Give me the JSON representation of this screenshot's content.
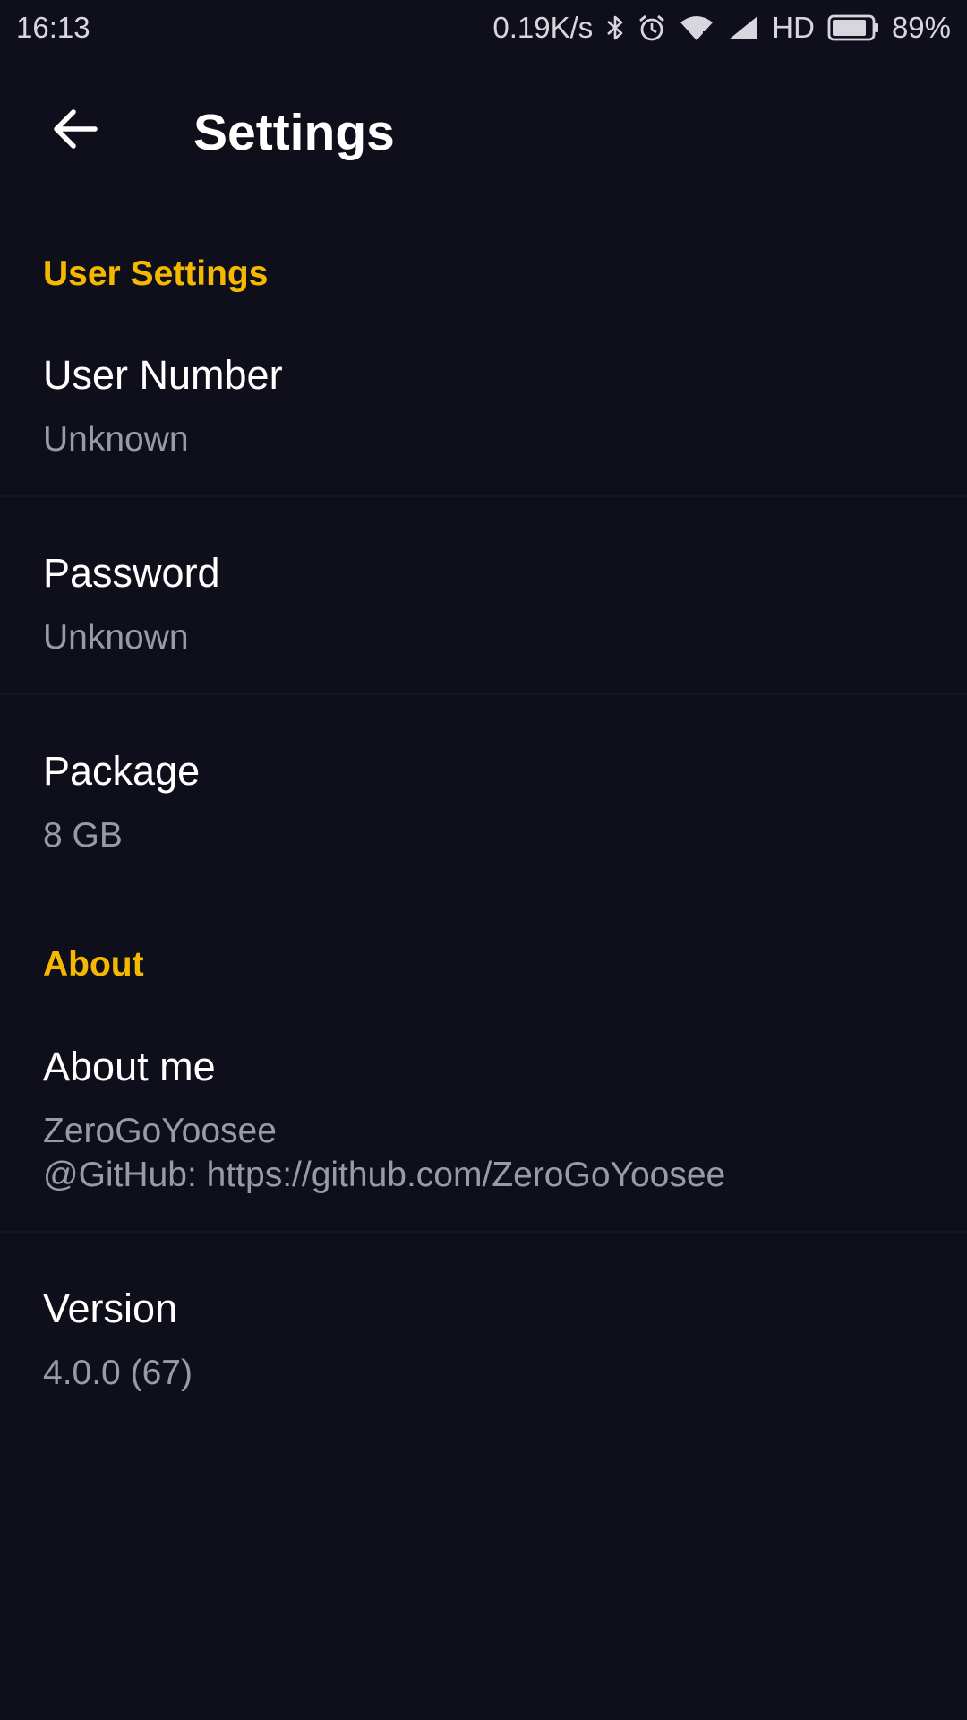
{
  "status_bar": {
    "time": "16:13",
    "net_speed": "0.19K/s",
    "network_type": "HD",
    "battery_percent": "89%",
    "battery_level": 0.89,
    "icons": [
      "bluetooth-icon",
      "alarm-icon",
      "wifi-icon",
      "cell-signal-icon",
      "battery-icon"
    ]
  },
  "app_bar": {
    "title": "Settings",
    "back_icon": "arrow-back-icon"
  },
  "sections": {
    "user_settings": {
      "header": "User Settings",
      "items": [
        {
          "title": "User Number",
          "summary": "Unknown"
        },
        {
          "title": "Password",
          "summary": "Unknown"
        },
        {
          "title": "Package",
          "summary": "8 GB"
        }
      ]
    },
    "about": {
      "header": "About",
      "items": [
        {
          "title": "About me",
          "summary_line1": "ZeroGoYoosee",
          "summary_line2": "@GitHub: https://github.com/ZeroGoYoosee"
        },
        {
          "title": "Version",
          "summary": "4.0.0 (67)"
        }
      ]
    }
  },
  "colors": {
    "background": "#0f0f1c",
    "accent": "#f5b800",
    "summary_text": "#9a9aa2"
  }
}
